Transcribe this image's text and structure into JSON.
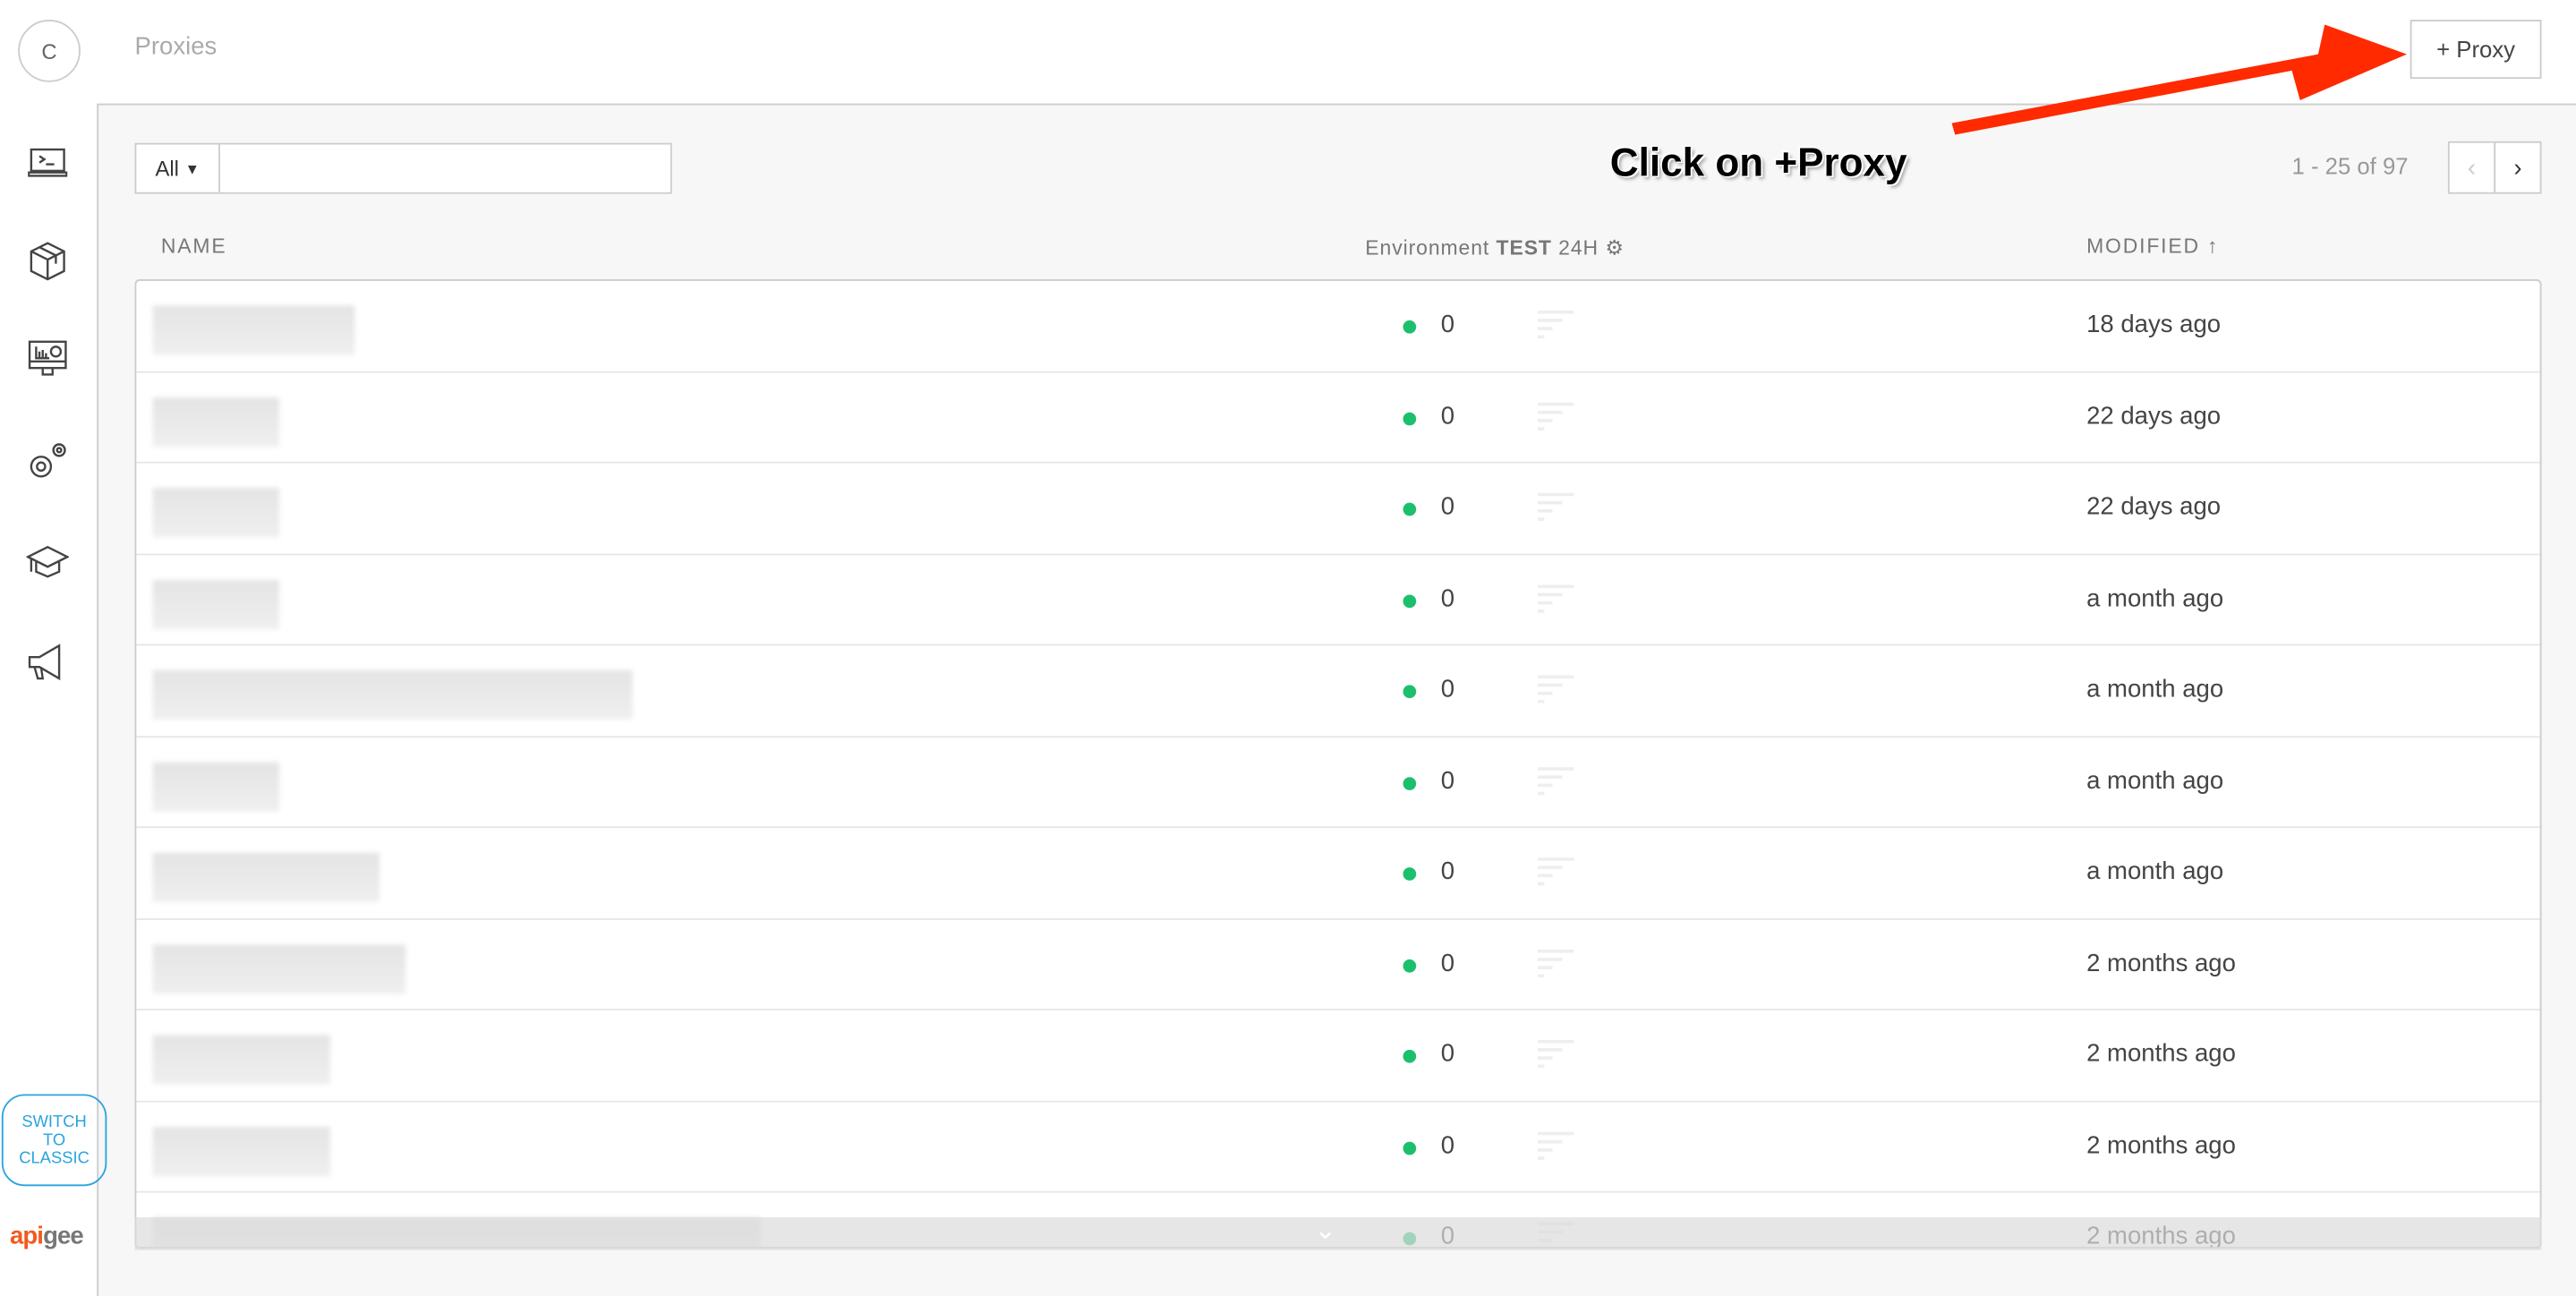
{
  "header": {
    "avatar_letter": "C",
    "title": "Proxies",
    "add_button": "+ Proxy"
  },
  "sidebar": {
    "items": [
      "terminal-icon",
      "package-icon",
      "analytics-icon",
      "settings-icon",
      "education-icon",
      "announcement-icon"
    ],
    "switch_label": [
      "SWITCH",
      "TO",
      "CLASSIC"
    ],
    "logo": "apigee"
  },
  "filter": {
    "selected": "All",
    "placeholder": ""
  },
  "annotation": "Click on +Proxy",
  "pagination": {
    "text": "1 - 25 of 97",
    "prev": "‹",
    "next": "›"
  },
  "columns": {
    "name": "NAME",
    "env_prefix": "Environment",
    "env_name": "TEST",
    "env_window": "24H",
    "modified": "MODIFIED ↑"
  },
  "rows": [
    {
      "traffic": "0",
      "modified": "18 days ago"
    },
    {
      "traffic": "0",
      "modified": "22 days ago"
    },
    {
      "traffic": "0",
      "modified": "22 days ago"
    },
    {
      "traffic": "0",
      "modified": "a month ago"
    },
    {
      "traffic": "0",
      "modified": "a month ago"
    },
    {
      "traffic": "0",
      "modified": "a month ago"
    },
    {
      "traffic": "0",
      "modified": "a month ago"
    },
    {
      "traffic": "0",
      "modified": "2 months ago"
    },
    {
      "traffic": "0",
      "modified": "2 months ago"
    },
    {
      "traffic": "0",
      "modified": "2 months ago"
    },
    {
      "traffic": "0",
      "modified": "2 months ago"
    }
  ],
  "colors": {
    "accent": "#29a3e0",
    "status": "#1cc06c",
    "arrow": "#ff2a00"
  }
}
